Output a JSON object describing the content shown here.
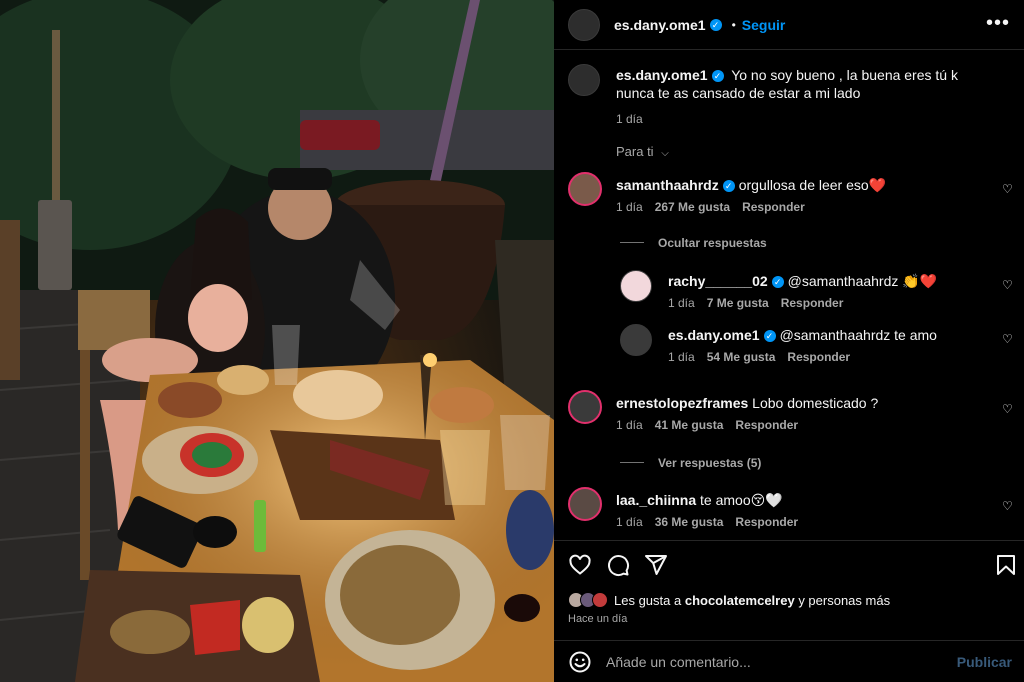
{
  "post": {
    "author": "es.dany.ome1",
    "follow_label": "Seguir",
    "separator": "•",
    "more_label": "•••",
    "caption": "Yo no soy bueno , la buena eres tú k nunca te as cansado de estar a mi lado",
    "caption_time": "1 día",
    "sort_label": "Para ti"
  },
  "comments": [
    {
      "user": "samanthaahrdz",
      "verified": true,
      "text": "orgullosa de leer eso❤️",
      "time": "1 día",
      "likes": "267 Me gusta",
      "reply": "Responder",
      "thread_label": "Ocultar respuestas",
      "replies": [
        {
          "user": "rachy______02",
          "verified": true,
          "text": "@samanthaahrdz 👏❤️",
          "time": "1 día",
          "likes": "7 Me gusta",
          "reply": "Responder"
        },
        {
          "user": "es.dany.ome1",
          "verified": true,
          "text": "@samanthaahrdz te amo",
          "time": "1 día",
          "likes": "54 Me gusta",
          "reply": "Responder"
        }
      ]
    },
    {
      "user": "ernestolopezframes",
      "verified": false,
      "text": "Lobo domesticado ?",
      "time": "1 día",
      "likes": "41 Me gusta",
      "reply": "Responder",
      "thread_label": "Ver respuestas (5)"
    },
    {
      "user": "laa._chiinna",
      "verified": false,
      "text": "te amoo😚🤍",
      "time": "1 día",
      "likes": "36 Me gusta",
      "reply": "Responder"
    }
  ],
  "likes": {
    "prefix": "Les gusta a",
    "user": "chocolatemcelrey",
    "suffix": "y personas más"
  },
  "posted_ago": "Hace un día",
  "add_comment": {
    "placeholder": "Añade un comentario...",
    "publish_label": "Publicar"
  },
  "colors": {
    "accent": "#0095f6",
    "muted": "#a8a8a8",
    "background": "#000000"
  },
  "icons": [
    "heart-icon",
    "comment-icon",
    "share-icon",
    "bookmark-icon",
    "emoji-icon",
    "verified-badge-icon",
    "more-options-icon",
    "chevron-down-icon"
  ]
}
